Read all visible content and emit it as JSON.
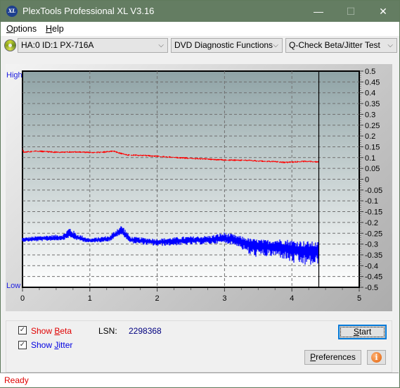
{
  "window": {
    "title": "PlexTools Professional XL V3.16",
    "app_icon": "XL",
    "controls": {
      "minimize": "—",
      "maximize": "☐",
      "close": "✕"
    }
  },
  "menu": {
    "items": [
      {
        "label": "Options",
        "underline": "O",
        "rest": "ptions"
      },
      {
        "label": "Help",
        "underline": "H",
        "rest": "elp"
      }
    ]
  },
  "toolbar": {
    "drive": "HA:0 ID:1  PX-716A",
    "function": "DVD Diagnostic Functions",
    "test": "Q-Check Beta/Jitter Test",
    "chevron": "⌵"
  },
  "chart": {
    "high_label": "High",
    "low_label": "Low",
    "cursor_position": 4.4
  },
  "chart_data": {
    "type": "line",
    "title": "Q-Check Beta/Jitter Test",
    "xlabel": "",
    "ylabel": "",
    "xlim": [
      0,
      5
    ],
    "ylim": [
      -0.5,
      0.5
    ],
    "x_ticks": [
      "0",
      "1",
      "2",
      "3",
      "4",
      "5"
    ],
    "y_ticks": [
      "0.5",
      "0.45",
      "0.4",
      "0.35",
      "0.3",
      "0.25",
      "0.2",
      "0.15",
      "0.1",
      "0.05",
      "0",
      "-0.05",
      "-0.1",
      "-0.15",
      "-0.2",
      "-0.25",
      "-0.3",
      "-0.35",
      "-0.4",
      "-0.45",
      "-0.5"
    ],
    "grid": true,
    "series": [
      {
        "name": "Beta",
        "color": "#ff0000",
        "x": [
          0,
          0.02,
          0.2,
          0.5,
          0.8,
          1.0,
          1.2,
          1.35,
          1.45,
          1.55,
          1.8,
          2.0,
          2.3,
          2.6,
          2.9,
          3.1,
          3.3,
          3.5,
          3.7,
          3.9,
          4.05,
          4.2,
          4.4
        ],
        "values": [
          0.14,
          0.125,
          0.13,
          0.125,
          0.126,
          0.124,
          0.125,
          0.13,
          0.12,
          0.112,
          0.11,
          0.106,
          0.1,
          0.095,
          0.09,
          0.088,
          0.088,
          0.084,
          0.082,
          0.078,
          0.08,
          0.083,
          0.08
        ],
        "noise": 0.004
      },
      {
        "name": "Jitter",
        "color": "#0000ff",
        "x": [
          0,
          0.3,
          0.6,
          0.7,
          0.8,
          1.0,
          1.3,
          1.42,
          1.48,
          1.6,
          1.8,
          2.0,
          2.4,
          2.8,
          3.0,
          3.2,
          3.4,
          3.6,
          3.8,
          4.0,
          4.2,
          4.4
        ],
        "values": [
          -0.28,
          -0.275,
          -0.27,
          -0.255,
          -0.27,
          -0.285,
          -0.275,
          -0.25,
          -0.245,
          -0.28,
          -0.285,
          -0.29,
          -0.285,
          -0.28,
          -0.275,
          -0.285,
          -0.3,
          -0.31,
          -0.31,
          -0.32,
          -0.33,
          -0.33
        ],
        "noise_top": [
          0.01,
          0.015,
          0.015,
          0.035,
          0.02,
          0.012,
          0.015,
          0.03,
          0.035,
          0.015,
          0.015,
          0.015,
          0.02,
          0.02,
          0.03,
          0.025,
          0.025,
          0.03,
          0.035,
          0.04,
          0.045,
          0.04
        ],
        "noise_bottom": [
          0.01,
          0.012,
          0.012,
          0.015,
          0.012,
          0.01,
          0.012,
          0.012,
          0.012,
          0.015,
          0.018,
          0.02,
          0.02,
          0.02,
          0.02,
          0.025,
          0.06,
          0.05,
          0.05,
          0.07,
          0.07,
          0.07
        ]
      }
    ]
  },
  "controls": {
    "show_beta": {
      "label_pre": "Show ",
      "label_ul": "B",
      "label_post": "eta",
      "checked": true,
      "color": "#e00000"
    },
    "show_jitter": {
      "label_pre": "Show ",
      "label_ul": "J",
      "label_post": "itter",
      "checked": true,
      "color": "#0000e0"
    },
    "lsn_label": "LSN:",
    "lsn_value": "2298368",
    "start_ul": "S",
    "start_rest": "tart",
    "preferences_ul": "P",
    "preferences_rest": "references",
    "info_glyph": "i"
  },
  "status": {
    "text": "Ready"
  }
}
